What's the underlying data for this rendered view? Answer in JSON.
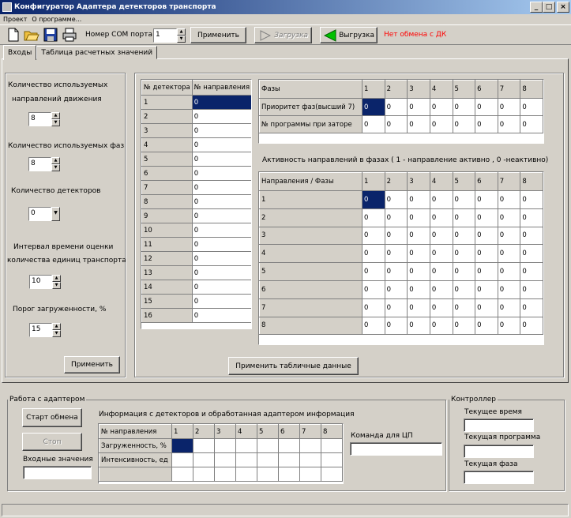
{
  "window": {
    "title": "Конфигуратор Адаптера детекторов транспорта",
    "min": "_",
    "max": "□",
    "close": "×"
  },
  "menu": [
    "Проект",
    "О программе..."
  ],
  "toolbar": {
    "com_label": "Номер COM порта",
    "com_value": "1",
    "apply": "Применить",
    "load": "Загрузка",
    "upload": "Выгрузка",
    "status": "Нет обмена с ДК",
    "status_color": "#ff0000"
  },
  "tabs": [
    "Входы",
    "Таблица расчетных значений"
  ],
  "left": {
    "dirs_label1": "Количество  используемых",
    "dirs_label2": "направлений движения",
    "dirs_value": "8",
    "phases_label": "Количество  используемых фаз",
    "phases_value": "8",
    "det_label": "Количество  детекторов",
    "det_value": "0",
    "interval_label1": "Интервал времени оценки",
    "interval_label2": "количества единиц транспорта",
    "interval_value": "10",
    "threshold_label": "Порог загруженности, %",
    "threshold_value": "15",
    "apply": "Применить"
  },
  "detectors": {
    "headers": [
      "№ детектора",
      "№ направления"
    ],
    "rows": [
      [
        "1",
        "0"
      ],
      [
        "2",
        "0"
      ],
      [
        "3",
        "0"
      ],
      [
        "4",
        "0"
      ],
      [
        "5",
        "0"
      ],
      [
        "6",
        "0"
      ],
      [
        "7",
        "0"
      ],
      [
        "8",
        "0"
      ],
      [
        "9",
        "0"
      ],
      [
        "10",
        "0"
      ],
      [
        "11",
        "0"
      ],
      [
        "12",
        "0"
      ],
      [
        "13",
        "0"
      ],
      [
        "14",
        "0"
      ],
      [
        "15",
        "0"
      ],
      [
        "16",
        "0"
      ]
    ]
  },
  "phases": {
    "headers": [
      "Фазы",
      "1",
      "2",
      "3",
      "4",
      "5",
      "6",
      "7",
      "8"
    ],
    "rows": [
      [
        "Приоритет фаз(высший 7)",
        "0",
        "0",
        "0",
        "0",
        "0",
        "0",
        "0",
        "0"
      ],
      [
        "№ программы при заторе",
        "0",
        "0",
        "0",
        "0",
        "0",
        "0",
        "0",
        "0"
      ]
    ]
  },
  "activity": {
    "caption": "Активность направлений в фазах   ( 1 - направление активно , 0 -неактивно)",
    "headers": [
      "Направления / Фазы",
      "1",
      "2",
      "3",
      "4",
      "5",
      "6",
      "7",
      "8"
    ],
    "rows": [
      [
        "1",
        "0",
        "0",
        "0",
        "0",
        "0",
        "0",
        "0",
        "0"
      ],
      [
        "2",
        "0",
        "0",
        "0",
        "0",
        "0",
        "0",
        "0",
        "0"
      ],
      [
        "3",
        "0",
        "0",
        "0",
        "0",
        "0",
        "0",
        "0",
        "0"
      ],
      [
        "4",
        "0",
        "0",
        "0",
        "0",
        "0",
        "0",
        "0",
        "0"
      ],
      [
        "5",
        "0",
        "0",
        "0",
        "0",
        "0",
        "0",
        "0",
        "0"
      ],
      [
        "6",
        "0",
        "0",
        "0",
        "0",
        "0",
        "0",
        "0",
        "0"
      ],
      [
        "7",
        "0",
        "0",
        "0",
        "0",
        "0",
        "0",
        "0",
        "0"
      ],
      [
        "8",
        "0",
        "0",
        "0",
        "0",
        "0",
        "0",
        "0",
        "0"
      ]
    ]
  },
  "apply_table": "Применить табличные данные",
  "adapter": {
    "legend": "Работа с адаптером",
    "start": "Старт обмена",
    "stop": "Стоп",
    "input_label": "Входные значения",
    "info_caption": "Информация с детекторов и обработанная адаптером информация",
    "info_headers": [
      "№ направления",
      "1",
      "2",
      "3",
      "4",
      "5",
      "6",
      "7",
      "8"
    ],
    "info_rows": [
      [
        "Загруженность, %",
        "",
        "",
        "",
        "",
        "",
        "",
        "",
        ""
      ],
      [
        "Интенсивность, ед",
        "",
        "",
        "",
        "",
        "",
        "",
        "",
        ""
      ],
      [
        "",
        "",
        "",
        "",
        "",
        "",
        "",
        "",
        ""
      ]
    ],
    "cmd_label": "Команда для ЦП"
  },
  "controller": {
    "legend": "Контроллер",
    "time_label": "Текущее время",
    "program_label": "Текущая программа",
    "phase_label": "Текущая фаза"
  }
}
